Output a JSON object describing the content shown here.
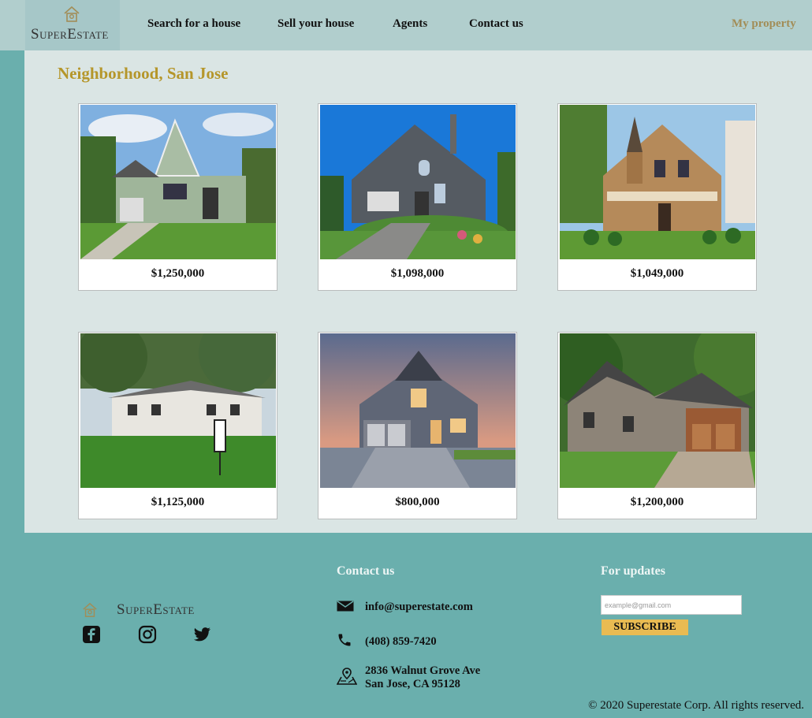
{
  "header": {
    "logo_text": "SuperEstate",
    "nav": [
      "Search for a house",
      "Sell your house",
      "Agents",
      "Contact us"
    ],
    "my_property": "My property"
  },
  "main": {
    "title": "Neighborhood, San Jose",
    "listings": [
      {
        "price": "$1,250,000",
        "image": "green-gabled-house-photo"
      },
      {
        "price": "$1,098,000",
        "image": "gray-stone-house-photo"
      },
      {
        "price": "$1,049,000",
        "image": "victorian-house-photo"
      },
      {
        "price": "$1,125,000",
        "image": "white-colonial-house-photo"
      },
      {
        "price": "$800,000",
        "image": "craftsman-house-dusk-photo"
      },
      {
        "price": "$1,200,000",
        "image": "stone-cedar-house-photo"
      }
    ]
  },
  "footer": {
    "logo_text": "SuperEstate",
    "social": [
      "facebook-icon",
      "instagram-icon",
      "twitter-icon"
    ],
    "contact_heading": "Contact us",
    "email": "info@superestate.com",
    "phone": "(408) 859-7420",
    "address_line1": "2836 Walnut Grove Ave",
    "address_line2": "San Jose, CA 95128",
    "updates_heading": "For updates",
    "email_placeholder": "example@gmail.com",
    "subscribe_label": "SUBSCRIBE",
    "copyright": "© 2020 Superestate Corp. All rights reserved."
  },
  "colors": {
    "header_bg": "#b1cecd",
    "main_bg": "#dae5e4",
    "footer_bg": "#6aafad",
    "title_gold": "#b5962a",
    "subscribe_bg": "#e9bb52"
  }
}
